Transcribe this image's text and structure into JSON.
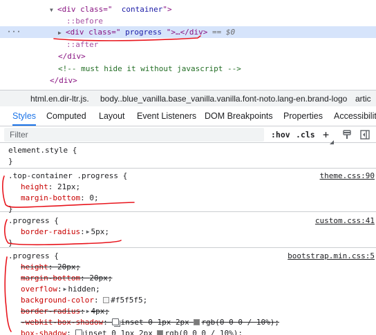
{
  "elements_tree": {
    "line1": {
      "open": "<div class=\"",
      "val": "  container",
      "close": "\">"
    },
    "line2": {
      "text": "::before"
    },
    "line3": {
      "dots": "···",
      "open": "<div class=\"",
      "val": " progress ",
      "mid": "\">…</div>",
      "eq": " == ",
      "dollar": "$0"
    },
    "line4": {
      "text": "::after"
    },
    "line5": {
      "text": "</div>"
    },
    "line6": {
      "text": "<!-- must hide it without javascript -->"
    },
    "line7": {
      "text": "</div>"
    }
  },
  "breadcrumb": {
    "items": [
      "html.en.dir-ltr.js.",
      "body..blue_vanilla.base_vanilla.vanilla.font-noto.lang-en.brand-logo",
      "artic"
    ]
  },
  "tabs": [
    "Styles",
    "Computed",
    "Layout",
    "Event Listeners",
    "DOM Breakpoints",
    "Properties",
    "Accessibility"
  ],
  "filter": {
    "placeholder": "Filter",
    "hov": ":hov",
    "cls": ".cls",
    "plus": "+"
  },
  "rules": [
    {
      "selector": "element.style {",
      "close": "}"
    },
    {
      "selector": ".top-container .progress {",
      "source": "theme.css:90",
      "props": [
        {
          "name": "height",
          "value": "21px;"
        },
        {
          "name": "margin-bottom",
          "value": "0;"
        }
      ],
      "close": "}"
    },
    {
      "selector": ".progress {",
      "source": "custom.css:41",
      "props": [
        {
          "name": "border-radius",
          "value": "5px;"
        }
      ],
      "close": "}"
    },
    {
      "selector": ".progress {",
      "source": "bootstrap.min.css:5",
      "props": [
        {
          "name": "height",
          "value": "20px;"
        },
        {
          "name": "margin-bottom",
          "value": "20px;"
        },
        {
          "name": "overflow",
          "value": "hidden;"
        },
        {
          "name": "background-color",
          "value": "#f5f5f5;"
        },
        {
          "name": "border-radius",
          "value": "4px;"
        },
        {
          "name": "-webkit-box-shadow",
          "value": "inset 0 1px 2px",
          "value2": "rgb(0 0 0 / 10%);"
        },
        {
          "name": "box-shadow",
          "value": "inset 0 1px 2px",
          "value2": "rgb(0 0 0 / 10%);"
        }
      ]
    }
  ],
  "colors": {
    "selected_row": "#d6e4fb",
    "accent": "#1a73e8",
    "annotation": "#e8141c",
    "swatch_bg": "#f5f5f5",
    "swatch_shadow": "#7a7a7a"
  }
}
